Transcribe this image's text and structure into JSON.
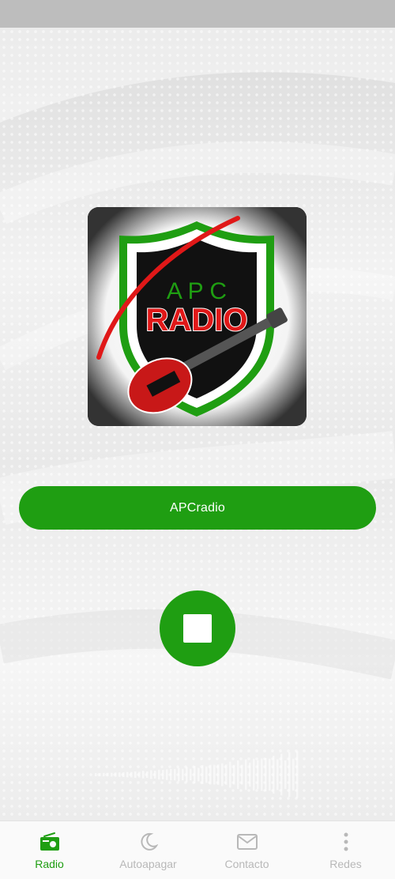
{
  "station": {
    "name": "APCradio"
  },
  "logo": {
    "letters": "A P C",
    "word": "RADIO"
  },
  "player": {
    "state": "playing",
    "control_icon": "stop-icon"
  },
  "nav": {
    "items": [
      {
        "label": "Radio",
        "icon": "radio-icon",
        "active": true
      },
      {
        "label": "Autoapagar",
        "icon": "moon-icon",
        "active": false
      },
      {
        "label": "Contacto",
        "icon": "mail-icon",
        "active": false
      },
      {
        "label": "Redes",
        "icon": "more-vertical-icon",
        "active": false
      }
    ]
  },
  "colors": {
    "accent": "#1f9e12",
    "inactive": "#b8b8b8",
    "logo_red": "#e01818"
  }
}
